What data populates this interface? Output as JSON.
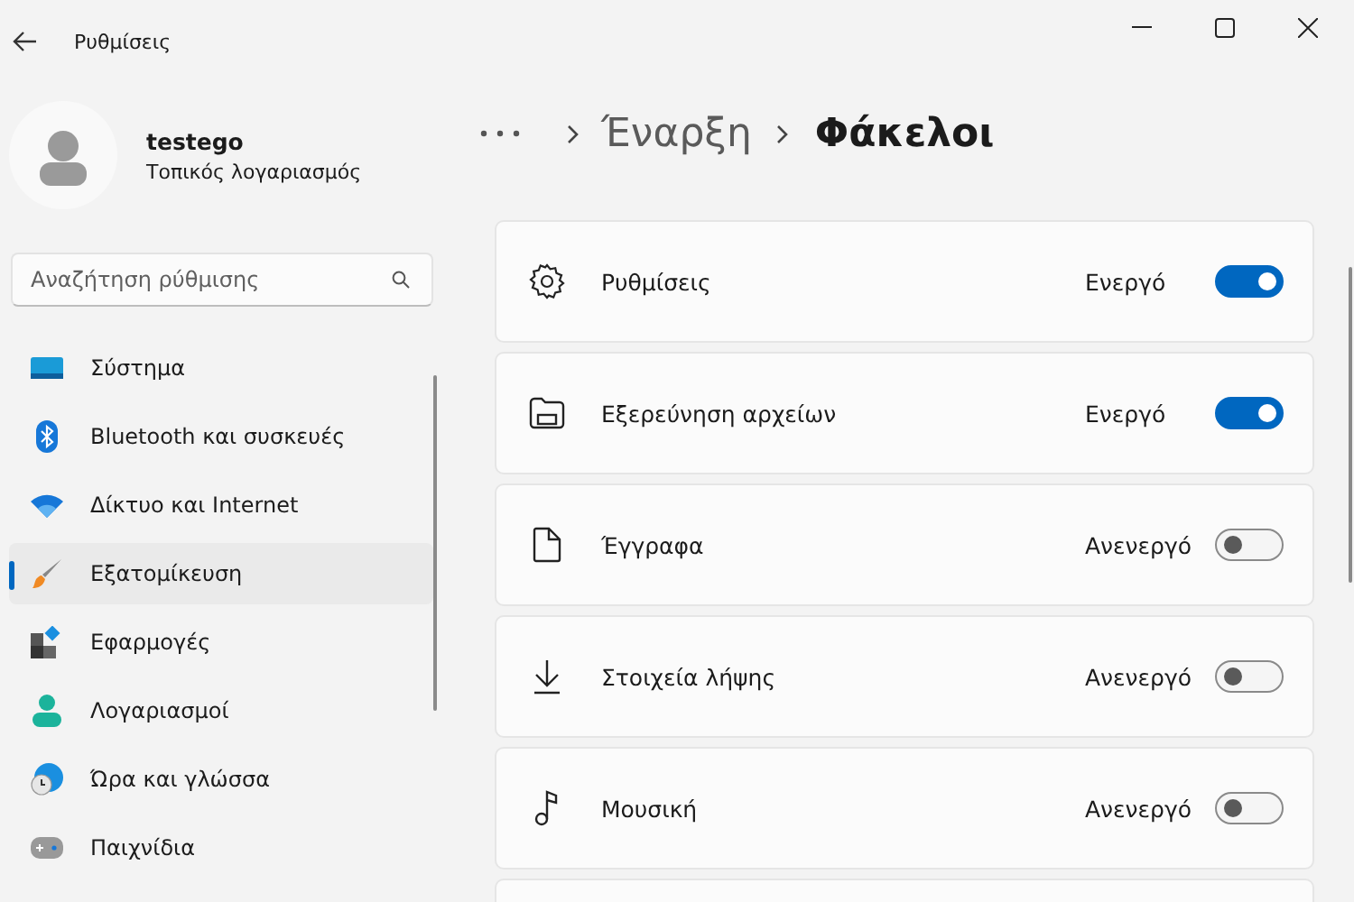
{
  "window": {
    "title": "Ρυθμίσεις"
  },
  "user": {
    "name": "testego",
    "account": "Τοπικός λογαριασμός"
  },
  "search": {
    "placeholder": "Αναζήτηση ρύθμισης"
  },
  "nav": {
    "items": [
      {
        "label": "Σύστημα",
        "kind": "system",
        "selected": false
      },
      {
        "label": "Bluetooth και συσκευές",
        "kind": "bluetooth",
        "selected": false
      },
      {
        "label": "Δίκτυο και Internet",
        "kind": "network",
        "selected": false
      },
      {
        "label": "Εξατομίκευση",
        "kind": "brush",
        "selected": true
      },
      {
        "label": "Εφαρμογές",
        "kind": "apps",
        "selected": false
      },
      {
        "label": "Λογαριασμοί",
        "kind": "person",
        "selected": false
      },
      {
        "label": "Ώρα και γλώσσα",
        "kind": "time",
        "selected": false
      },
      {
        "label": "Παιχνίδια",
        "kind": "games",
        "selected": false
      }
    ]
  },
  "breadcrumb": {
    "parent": "Έναρξη",
    "current": "Φάκελοι"
  },
  "folders": [
    {
      "name": "Ρυθμίσεις",
      "kind": "gear",
      "state_label": "Ενεργό",
      "on": true
    },
    {
      "name": "Εξερεύνηση αρχείων",
      "kind": "folder",
      "state_label": "Ενεργό",
      "on": true
    },
    {
      "name": "Έγγραφα",
      "kind": "document",
      "state_label": "Ανενεργό",
      "on": false
    },
    {
      "name": "Στοιχεία λήψης",
      "kind": "download",
      "state_label": "Ανενεργό",
      "on": false
    },
    {
      "name": "Μουσική",
      "kind": "music",
      "state_label": "Ανενεργό",
      "on": false
    }
  ]
}
